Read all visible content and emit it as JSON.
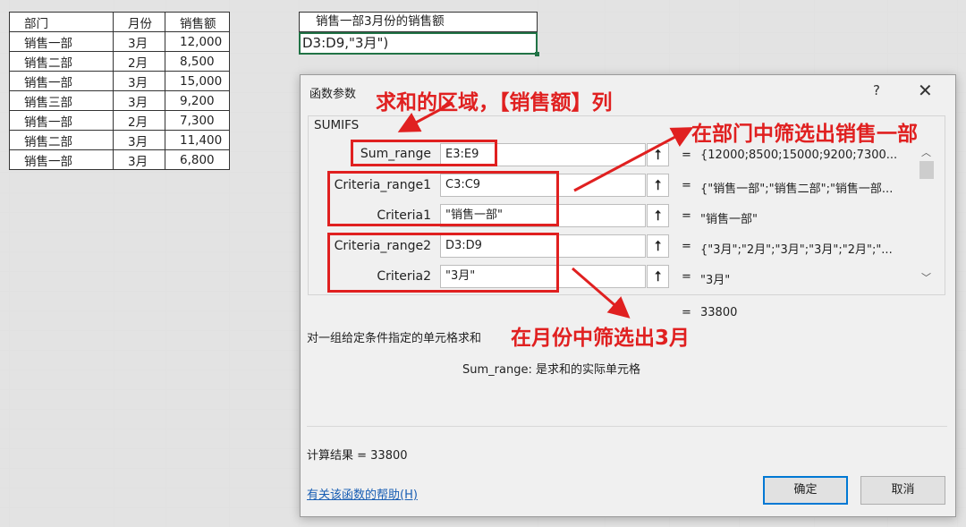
{
  "sheet": {
    "headers": [
      "部门",
      "月份",
      "销售额"
    ],
    "rows": [
      [
        "销售一部",
        "3月",
        "12,000"
      ],
      [
        "销售二部",
        "2月",
        "8,500"
      ],
      [
        "销售一部",
        "3月",
        "15,000"
      ],
      [
        "销售三部",
        "3月",
        "9,200"
      ],
      [
        "销售一部",
        "2月",
        "7,300"
      ],
      [
        "销售二部",
        "3月",
        "11,400"
      ],
      [
        "销售一部",
        "3月",
        "6,800"
      ]
    ],
    "title_cell": "销售一部3月份的销售额",
    "formula_cell": "D3:D9,\"3月\")"
  },
  "dialog": {
    "title": "函数参数",
    "help_glyph": "?",
    "close_glyph": "✕",
    "function_name": "SUMIFS",
    "args": [
      {
        "label": "Sum_range",
        "value": "E3:E9",
        "result": "{12000;8500;15000;9200;7300..."
      },
      {
        "label": "Criteria_range1",
        "value": "C3:C9",
        "result": "{\"销售一部\";\"销售二部\";\"销售一部..."
      },
      {
        "label": "Criteria1",
        "value": "\"销售一部\"",
        "result": "\"销售一部\""
      },
      {
        "label": "Criteria_range2",
        "value": "D3:D9",
        "result": "{\"3月\";\"2月\";\"3月\";\"3月\";\"2月\";\"..."
      },
      {
        "label": "Criteria2",
        "value": "\"3月\"",
        "result": "\"3月\""
      }
    ],
    "equals": "=",
    "total_result": "33800",
    "description": "对一组给定条件指定的单元格求和",
    "param_description": "Sum_range:  是求和的实际单元格",
    "calc_result": "计算结果 =   33800",
    "help_link": "有关该函数的帮助(H)",
    "ok_label": "确定",
    "cancel_label": "取消",
    "ref_icon": "collapse-dialog-icon"
  },
  "annotations": {
    "note1": "求和的区域，【销售额】列",
    "note2": "在部门中筛选出销售一部",
    "note3": "在月份中筛选出3月",
    "color": "#e02020"
  }
}
